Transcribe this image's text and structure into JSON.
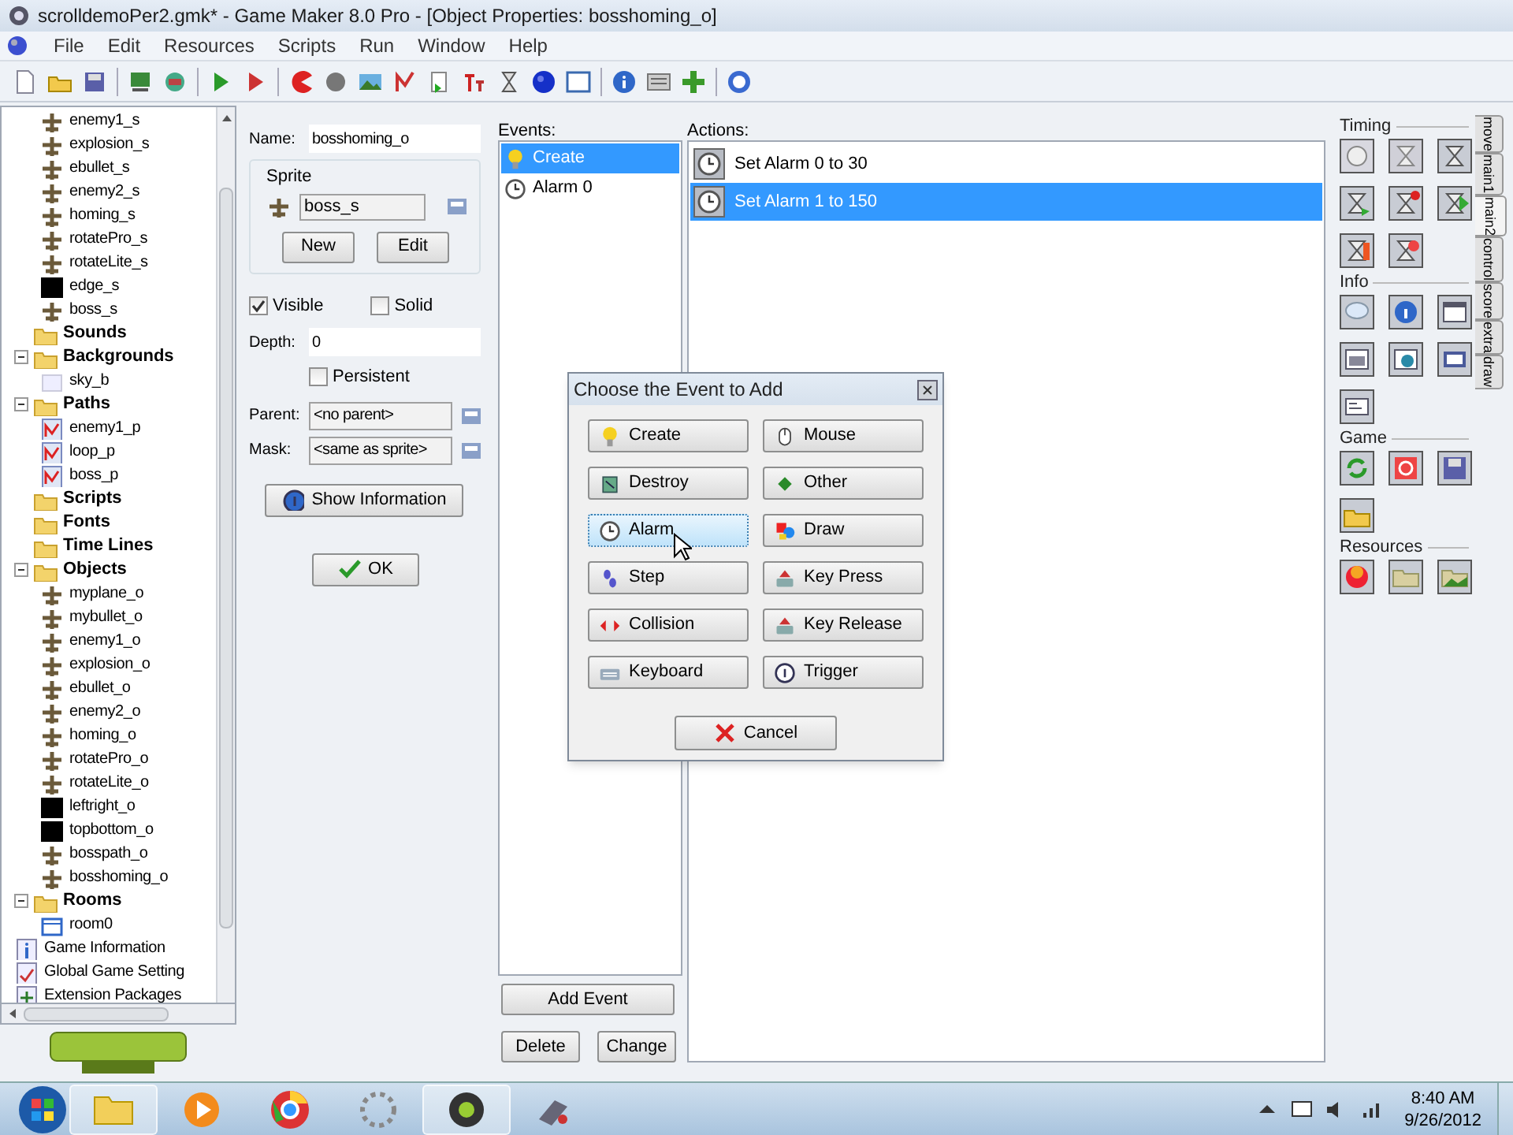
{
  "window": {
    "title": "scrolldemoPer2.gmk* - Game Maker 8.0 Pro - [Object Properties: bosshoming_o]"
  },
  "menu": [
    "File",
    "Edit",
    "Resources",
    "Scripts",
    "Run",
    "Window",
    "Help"
  ],
  "tree": [
    {
      "children": [
        {
          "label": "enemy1_s",
          "kind": "sprite"
        },
        {
          "label": "explosion_s",
          "kind": "sprite"
        },
        {
          "label": "ebullet_s",
          "kind": "sprite"
        },
        {
          "label": "enemy2_s",
          "kind": "sprite"
        },
        {
          "label": "homing_s",
          "kind": "sprite"
        },
        {
          "label": "rotatePro_s",
          "kind": "sprite"
        },
        {
          "label": "rotateLite_s",
          "kind": "sprite"
        },
        {
          "label": "edge_s",
          "kind": "block"
        },
        {
          "label": "boss_s",
          "kind": "sprite"
        }
      ]
    },
    {
      "label": "Sounds",
      "kind": "folder",
      "expanded": false
    },
    {
      "label": "Backgrounds",
      "kind": "folder",
      "expanded": true,
      "children": [
        {
          "label": "sky_b",
          "kind": "background"
        }
      ]
    },
    {
      "label": "Paths",
      "kind": "folder",
      "expanded": true,
      "children": [
        {
          "label": "enemy1_p",
          "kind": "path"
        },
        {
          "label": "loop_p",
          "kind": "path"
        },
        {
          "label": "boss_p",
          "kind": "path"
        }
      ]
    },
    {
      "label": "Scripts",
      "kind": "folder",
      "expanded": false
    },
    {
      "label": "Fonts",
      "kind": "folder",
      "expanded": false
    },
    {
      "label": "Time Lines",
      "kind": "folder",
      "expanded": false
    },
    {
      "label": "Objects",
      "kind": "folder",
      "expanded": true,
      "children": [
        {
          "label": "myplane_o",
          "kind": "sprite"
        },
        {
          "label": "mybullet_o",
          "kind": "sprite"
        },
        {
          "label": "enemy1_o",
          "kind": "sprite"
        },
        {
          "label": "explosion_o",
          "kind": "sprite"
        },
        {
          "label": "ebullet_o",
          "kind": "sprite"
        },
        {
          "label": "enemy2_o",
          "kind": "sprite"
        },
        {
          "label": "homing_o",
          "kind": "sprite"
        },
        {
          "label": "rotatePro_o",
          "kind": "sprite"
        },
        {
          "label": "rotateLite_o",
          "kind": "sprite"
        },
        {
          "label": "leftright_o",
          "kind": "block"
        },
        {
          "label": "topbottom_o",
          "kind": "block"
        },
        {
          "label": "bosspath_o",
          "kind": "sprite"
        },
        {
          "label": "bosshoming_o",
          "kind": "sprite"
        }
      ]
    },
    {
      "label": "Rooms",
      "kind": "folder",
      "expanded": true,
      "children": [
        {
          "label": "room0",
          "kind": "room"
        }
      ]
    },
    {
      "label": "Game Information",
      "kind": "info"
    },
    {
      "label": "Global Game Setting",
      "kind": "settings"
    },
    {
      "label": "Extension Packages",
      "kind": "extension"
    }
  ],
  "properties": {
    "name_label": "Name:",
    "name": "bosshoming_o",
    "sprite_label": "Sprite",
    "sprite": "boss_s",
    "new": "New",
    "edit": "Edit",
    "visible": {
      "label": "Visible",
      "checked": true
    },
    "solid": {
      "label": "Solid",
      "checked": false
    },
    "depth_label": "Depth:",
    "depth": "0",
    "persistent": {
      "label": "Persistent",
      "checked": false
    },
    "parent_label": "Parent:",
    "parent": "<no parent>",
    "mask_label": "Mask:",
    "mask": "<same as sprite>",
    "show_info": "Show Information",
    "ok": "OK"
  },
  "events": {
    "label": "Events:",
    "items": [
      {
        "label": "Create",
        "kind": "create",
        "selected": true
      },
      {
        "label": "Alarm 0",
        "kind": "alarm",
        "selected": false
      }
    ],
    "add": "Add Event",
    "delete": "Delete",
    "change": "Change"
  },
  "actions": {
    "label": "Actions:",
    "items": [
      {
        "label": "Set Alarm 0 to 30",
        "selected": false
      },
      {
        "label": "Set Alarm 1 to 150",
        "selected": true
      }
    ]
  },
  "library": {
    "groups": [
      {
        "title": "Timing"
      },
      {
        "title": "Info"
      },
      {
        "title": "Game"
      },
      {
        "title": "Resources"
      }
    ],
    "tabs": [
      {
        "label": "move",
        "selected": false
      },
      {
        "label": "main1",
        "selected": false
      },
      {
        "label": "main2",
        "selected": true
      },
      {
        "label": "control",
        "selected": false
      },
      {
        "label": "score",
        "selected": false
      },
      {
        "label": "extra",
        "selected": false
      },
      {
        "label": "draw",
        "selected": false
      }
    ]
  },
  "dialog": {
    "title": "Choose the Event to Add",
    "buttons": [
      {
        "label": "Create",
        "kind": "create",
        "highlighted": false
      },
      {
        "label": "Mouse",
        "kind": "mouse",
        "highlighted": false
      },
      {
        "label": "Destroy",
        "kind": "destroy",
        "highlighted": false
      },
      {
        "label": "Other",
        "kind": "other",
        "highlighted": false
      },
      {
        "label": "Alarm",
        "kind": "alarm",
        "highlighted": true
      },
      {
        "label": "Draw",
        "kind": "draw",
        "highlighted": false
      },
      {
        "label": "Step",
        "kind": "step",
        "highlighted": false
      },
      {
        "label": "Key Press",
        "kind": "key",
        "highlighted": false
      },
      {
        "label": "Collision",
        "kind": "collision",
        "highlighted": false
      },
      {
        "label": "Key Release",
        "kind": "key",
        "highlighted": false
      },
      {
        "label": "Keyboard",
        "kind": "keyboard",
        "highlighted": false
      },
      {
        "label": "Trigger",
        "kind": "trigger",
        "highlighted": false
      }
    ],
    "cancel": "Cancel"
  },
  "taskbar": {
    "time": "8:40 AM",
    "date": "9/26/2012"
  }
}
